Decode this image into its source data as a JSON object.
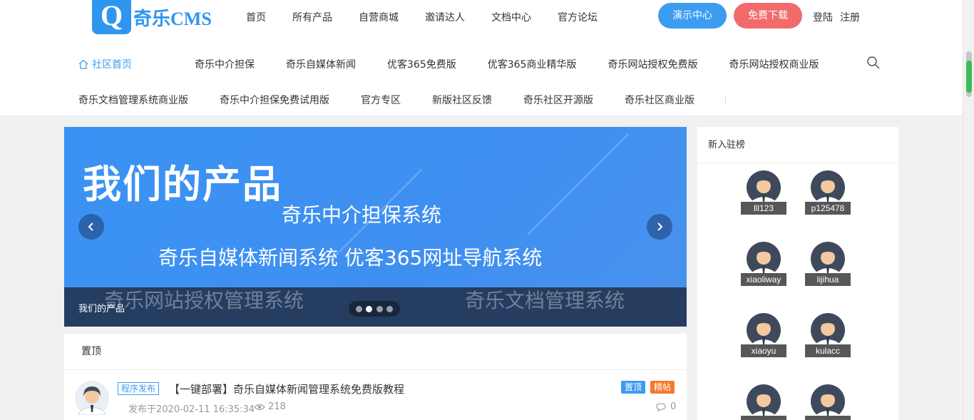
{
  "header": {
    "logo_letter": "Q",
    "logo_text": "奇乐CMS",
    "nav": [
      "首页",
      "所有产品",
      "自营商城",
      "邀请达人",
      "文档中心",
      "官方论坛"
    ],
    "demo_button": "演示中心",
    "download_button": "免费下载",
    "login": "登陆",
    "register": "注册"
  },
  "subnav": {
    "home": "社区首页",
    "row1": [
      "奇乐中介担保",
      "奇乐自媒体新闻",
      "优客365免费版",
      "优客365商业精华版",
      "奇乐网站授权免费版",
      "奇乐网站授权商业版"
    ],
    "row2": [
      "奇乐文档管理系统商业版",
      "奇乐中介担保免费试用版",
      "官方专区",
      "新版社区反馈",
      "奇乐社区开源版",
      "奇乐社区商业版"
    ]
  },
  "banner": {
    "title": "我们的产品",
    "line1": "奇乐中介担保系统",
    "line2": "奇乐自媒体新闻系统    优客365网址导航系统",
    "line3": "奇乐网站授权管理系统",
    "line4": "奇乐文档管理系统",
    "caption": "我们的产品",
    "slide_count": 4,
    "active_slide": 2
  },
  "pinned": {
    "heading": "置顶",
    "post": {
      "tag": "程序发布",
      "title": "【一键部署】奇乐自媒体新闻管理系统免费版教程",
      "meta": "发布于2020-02-11 16:35:34",
      "views": "218",
      "badge_top": "置顶",
      "badge_fine": "精帖",
      "comments": "0"
    }
  },
  "sidebar": {
    "heading": "新入驻榜",
    "members": [
      "lll123",
      "p125478",
      "xiaoliway",
      "lijihua",
      "xiaoyu",
      "kulacc",
      "",
      ""
    ]
  },
  "colors": {
    "accent": "#3b9cf0",
    "download": "#f26b6b",
    "fine_badge": "#f5792a"
  }
}
